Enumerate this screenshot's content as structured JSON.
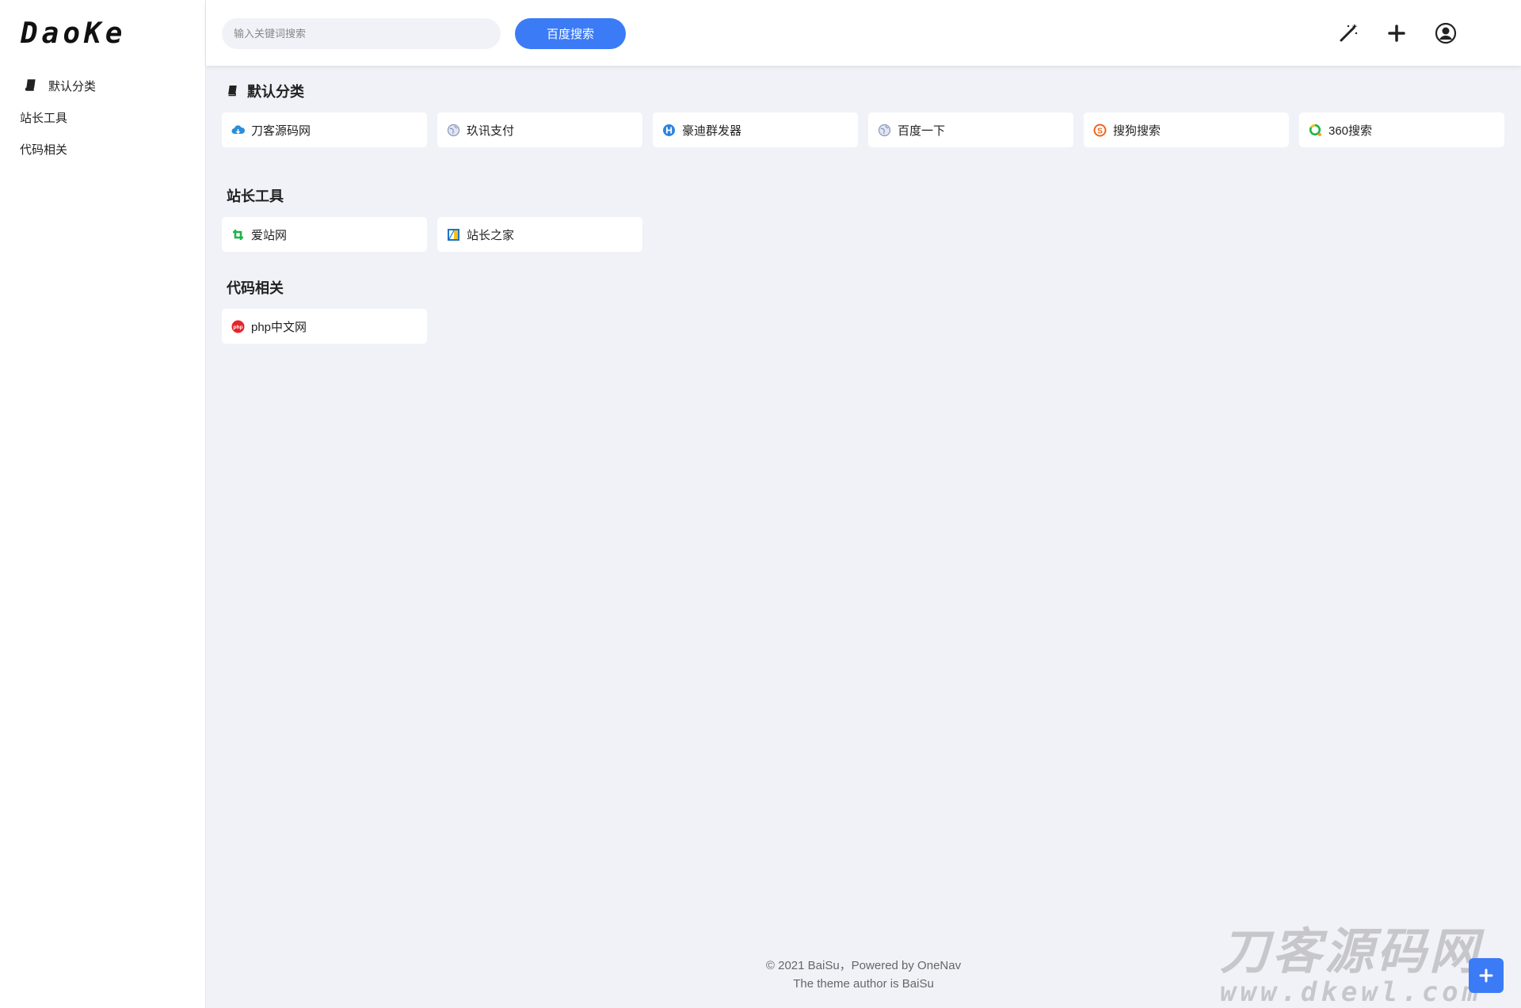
{
  "sidebar": {
    "logo": "DaoKe",
    "items": [
      {
        "label": "默认分类",
        "icon": "book-icon"
      },
      {
        "label": "站长工具"
      },
      {
        "label": "代码相关"
      }
    ]
  },
  "header": {
    "search_placeholder": "输入关键词搜索",
    "search_button": "百度搜索",
    "icons": [
      "magic-wand-icon",
      "plus-icon",
      "user-circle-icon"
    ]
  },
  "sections": [
    {
      "title": "默认分类",
      "icon": "book-icon",
      "links": [
        {
          "label": "刀客源码网",
          "icon": "cloud-download-icon"
        },
        {
          "label": "玖讯支付",
          "icon": "globe-icon"
        },
        {
          "label": "豪迪群发器",
          "icon": "h-badge-icon"
        },
        {
          "label": "百度一下",
          "icon": "globe-icon"
        },
        {
          "label": "搜狗搜索",
          "icon": "sogou-icon"
        },
        {
          "label": "360搜索",
          "icon": "360-icon"
        }
      ]
    },
    {
      "title": "站长工具",
      "links": [
        {
          "label": "爱站网",
          "icon": "aizhan-icon"
        },
        {
          "label": "站长之家",
          "icon": "chinaz-icon"
        }
      ]
    },
    {
      "title": "代码相关",
      "links": [
        {
          "label": "php中文网",
          "icon": "php-icon"
        }
      ]
    }
  ],
  "footer": {
    "line1": "© 2021 BaiSu，Powered by OneNav",
    "line2": "The theme author is BaiSu"
  },
  "watermark": {
    "line1": "刀客源码网",
    "line2": "www.dkewl.com"
  },
  "colors": {
    "accent": "#3c7bf6",
    "background": "#f1f2f8",
    "card": "#ffffff"
  }
}
